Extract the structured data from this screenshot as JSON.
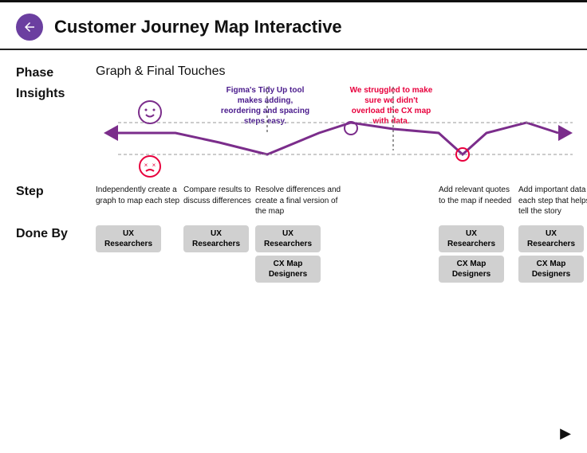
{
  "header": {
    "title": "Customer Journey Map Interactive",
    "back_label": "back"
  },
  "phase": {
    "label": "Phase",
    "value": "Graph & Final Touches"
  },
  "insights": {
    "label": "Insights",
    "bubble_left": "Figma's Tidy Up tool makes adding, reordering and spacing steps easy.",
    "bubble_right": "We struggled to make sure we didn't overload the CX map with data."
  },
  "steps": {
    "label": "Step",
    "items": [
      "Independently create a graph to map each step",
      "Compare results to discuss differences",
      "Resolve differences and create a final version of the map",
      "",
      "Add relevant quotes to the map if needed",
      "Add important data to each step that helps tell the story"
    ]
  },
  "done_by": {
    "label": "Done By",
    "cols": [
      [
        "UX Researchers"
      ],
      [
        "UX Researchers"
      ],
      [
        "UX Researchers",
        "CX Map Designers"
      ],
      [],
      [
        "UX Researchers",
        "CX Map Designers"
      ],
      [
        "UX Researchers",
        "CX Map Designers"
      ]
    ]
  },
  "colors": {
    "accent_purple": "#6b3fa0",
    "accent_red": "#e8003d",
    "line_purple": "#7b2d8b",
    "badge_bg": "#c8c8c8"
  }
}
